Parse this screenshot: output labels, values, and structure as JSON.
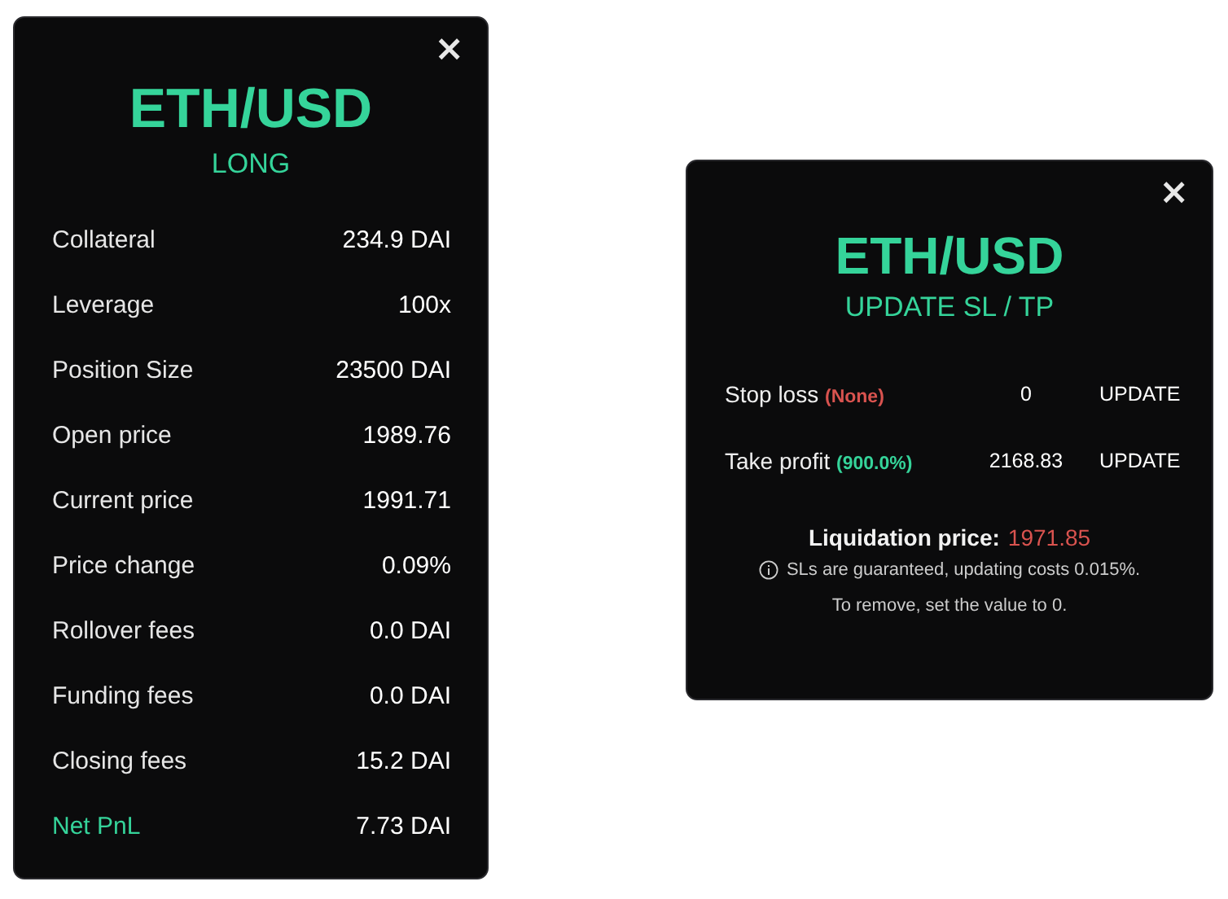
{
  "position_panel": {
    "close": "×",
    "title": "ETH/USD",
    "side": "LONG",
    "rows": [
      {
        "label": "Collateral",
        "value": "234.9 DAI",
        "highlight": false
      },
      {
        "label": "Leverage",
        "value": "100x",
        "highlight": false
      },
      {
        "label": "Position Size",
        "value": "23500 DAI",
        "highlight": false
      },
      {
        "label": "Open price",
        "value": "1989.76",
        "highlight": false
      },
      {
        "label": "Current price",
        "value": "1991.71",
        "highlight": false
      },
      {
        "label": "Price change",
        "value": "0.09%",
        "highlight": false
      },
      {
        "label": "Rollover fees",
        "value": "0.0 DAI",
        "highlight": false
      },
      {
        "label": "Funding fees",
        "value": "0.0 DAI",
        "highlight": false
      },
      {
        "label": "Closing fees",
        "value": "15.2 DAI",
        "highlight": false
      },
      {
        "label": "Net PnL",
        "value": "7.73 DAI",
        "highlight": true
      }
    ]
  },
  "update_panel": {
    "close": "×",
    "title": "ETH/USD",
    "subtitle": "UPDATE SL / TP",
    "rows": [
      {
        "label": "Stop loss",
        "note": "(None)",
        "color": "#d9534f",
        "value": "0",
        "button": "UPDATE"
      },
      {
        "label": "Take profit",
        "note": "(900.0%)",
        "color": "#35d49a",
        "value": "2168.83",
        "button": "UPDATE"
      }
    ],
    "liquidation_label": "Liquidation price:",
    "liquidation_value": "1971.85",
    "info": "SLs are guaranteed, updating costs 0.015%.",
    "hint": "To remove, set the value to 0."
  }
}
